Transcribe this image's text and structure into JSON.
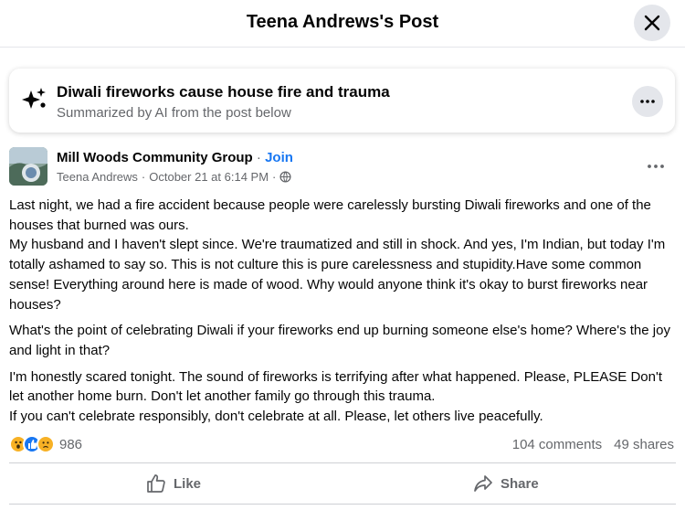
{
  "header": {
    "title": "Teena Andrews's Post"
  },
  "ai_summary": {
    "title": "Diwali fireworks cause house fire and trauma",
    "subtitle": "Summarized by AI from the post below"
  },
  "post": {
    "group_name": "Mill Woods Community Group",
    "join_label": "Join",
    "author": "Teena Andrews",
    "timestamp": "October 21 at 6:14 PM",
    "paragraphs": [
      "Last night, we had a fire accident because people were carelessly bursting Diwali fireworks and one of the houses that burned was ours.",
      "My husband and I haven't slept since. We're traumatized and still in shock. And yes, I'm Indian, but today I'm totally ashamed to say so. This is not culture this is pure carelessness and stupidity.Have some common sense! Everything around here is made of wood. Why would anyone think it's okay to burst fireworks near houses?",
      "What's the point of celebrating Diwali if your fireworks end up burning someone else's home? Where's the joy and light in that?",
      "I'm honestly scared tonight. The sound of fireworks is terrifying after what happened. Please, PLEASE Don't let another home burn. Don't let another family go through this trauma.",
      "If you can't celebrate responsibly, don't celebrate at all. Please, let others live peacefully."
    ],
    "reaction_icons": [
      "wow-reaction-icon",
      "like-reaction-icon",
      "sad-reaction-icon"
    ],
    "reaction_count": "986",
    "comments": "104 comments",
    "shares": "49 shares"
  },
  "actions": {
    "like_label": "Like",
    "share_label": "Share"
  },
  "colors": {
    "accent": "#1877f2",
    "muted": "#65676b",
    "button_bg": "#e4e6eb",
    "like_blue": "#1877f2",
    "wow_yellow": "#f7b125",
    "sad_yellow": "#f7b125"
  }
}
